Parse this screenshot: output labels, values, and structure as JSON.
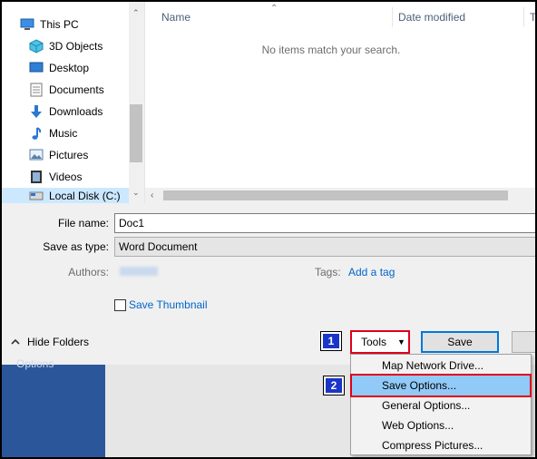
{
  "nav": {
    "items": [
      {
        "label": "This PC",
        "icon": "this-pc-icon"
      },
      {
        "label": "3D Objects",
        "icon": "3d-objects-icon"
      },
      {
        "label": "Desktop",
        "icon": "desktop-icon"
      },
      {
        "label": "Documents",
        "icon": "documents-icon"
      },
      {
        "label": "Downloads",
        "icon": "downloads-icon"
      },
      {
        "label": "Music",
        "icon": "music-icon"
      },
      {
        "label": "Pictures",
        "icon": "pictures-icon"
      },
      {
        "label": "Videos",
        "icon": "videos-icon"
      },
      {
        "label": "Local Disk (C:)",
        "icon": "local-disk-icon"
      }
    ]
  },
  "file_list": {
    "columns": [
      "Name",
      "Date modified",
      "Ty"
    ],
    "empty_message": "No items match your search."
  },
  "form": {
    "file_name_label": "File name:",
    "file_name_value": "Doc1",
    "save_as_type_label": "Save as type:",
    "save_as_type_value": "Word Document",
    "authors_label": "Authors:",
    "tags_label": "Tags:",
    "tags_link": "Add a tag",
    "save_thumbnail_label": "Save Thumbnail"
  },
  "footer": {
    "hide_folders": "Hide Folders",
    "tools_label": "Tools",
    "save_label": "Save"
  },
  "badges": [
    "1",
    "2"
  ],
  "tools_menu": {
    "items": [
      "Map Network Drive...",
      "Save Options...",
      "General Options...",
      "Web Options...",
      "Compress Pictures..."
    ],
    "highlighted_index": 1
  },
  "background": {
    "sidebar_label": "Options"
  },
  "colors": {
    "annotation_red": "#e0001a",
    "badge_blue": "#1a35c7",
    "highlight": "#91c9f7",
    "word_blue": "#2b579a",
    "link": "#0066cc"
  }
}
